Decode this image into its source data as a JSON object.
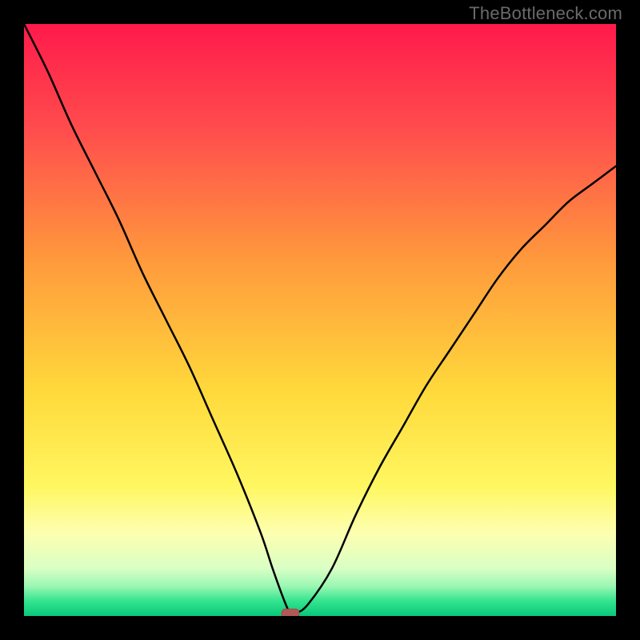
{
  "watermark": "TheBottleneck.com",
  "colors": {
    "page_bg": "#000000",
    "curve": "#000000",
    "marker_fill": "#b15a55",
    "marker_stroke": "#9e4b46",
    "gradient_stops": [
      {
        "offset": "0%",
        "color": "#ff1a4b"
      },
      {
        "offset": "18%",
        "color": "#ff4d4d"
      },
      {
        "offset": "40%",
        "color": "#ff9a3c"
      },
      {
        "offset": "62%",
        "color": "#ffd93b"
      },
      {
        "offset": "78%",
        "color": "#fff760"
      },
      {
        "offset": "86%",
        "color": "#fdffb0"
      },
      {
        "offset": "92%",
        "color": "#d9ffc5"
      },
      {
        "offset": "95%",
        "color": "#99f7b2"
      },
      {
        "offset": "97.5%",
        "color": "#33e38e"
      },
      {
        "offset": "100%",
        "color": "#08c97a"
      }
    ]
  },
  "chart_data": {
    "type": "line",
    "title": "",
    "xlabel": "",
    "ylabel": "",
    "x_range": [
      0,
      100
    ],
    "y_range": [
      0,
      100
    ],
    "minimum_marker": {
      "x": 45.0,
      "y": 0.5
    },
    "series": [
      {
        "name": "curve",
        "x": [
          0,
          4,
          8,
          12,
          16,
          20,
          24,
          28,
          32,
          36,
          40,
          42,
          44,
          45,
          46,
          48,
          52,
          56,
          60,
          64,
          68,
          72,
          76,
          80,
          84,
          88,
          92,
          96,
          100
        ],
        "y": [
          100,
          92,
          83,
          75,
          67,
          58,
          50,
          42,
          33,
          24,
          14,
          8,
          2.5,
          0.5,
          0.5,
          2,
          8,
          17,
          25,
          32,
          39,
          45,
          51,
          57,
          62,
          66,
          70,
          73,
          76
        ]
      }
    ]
  }
}
